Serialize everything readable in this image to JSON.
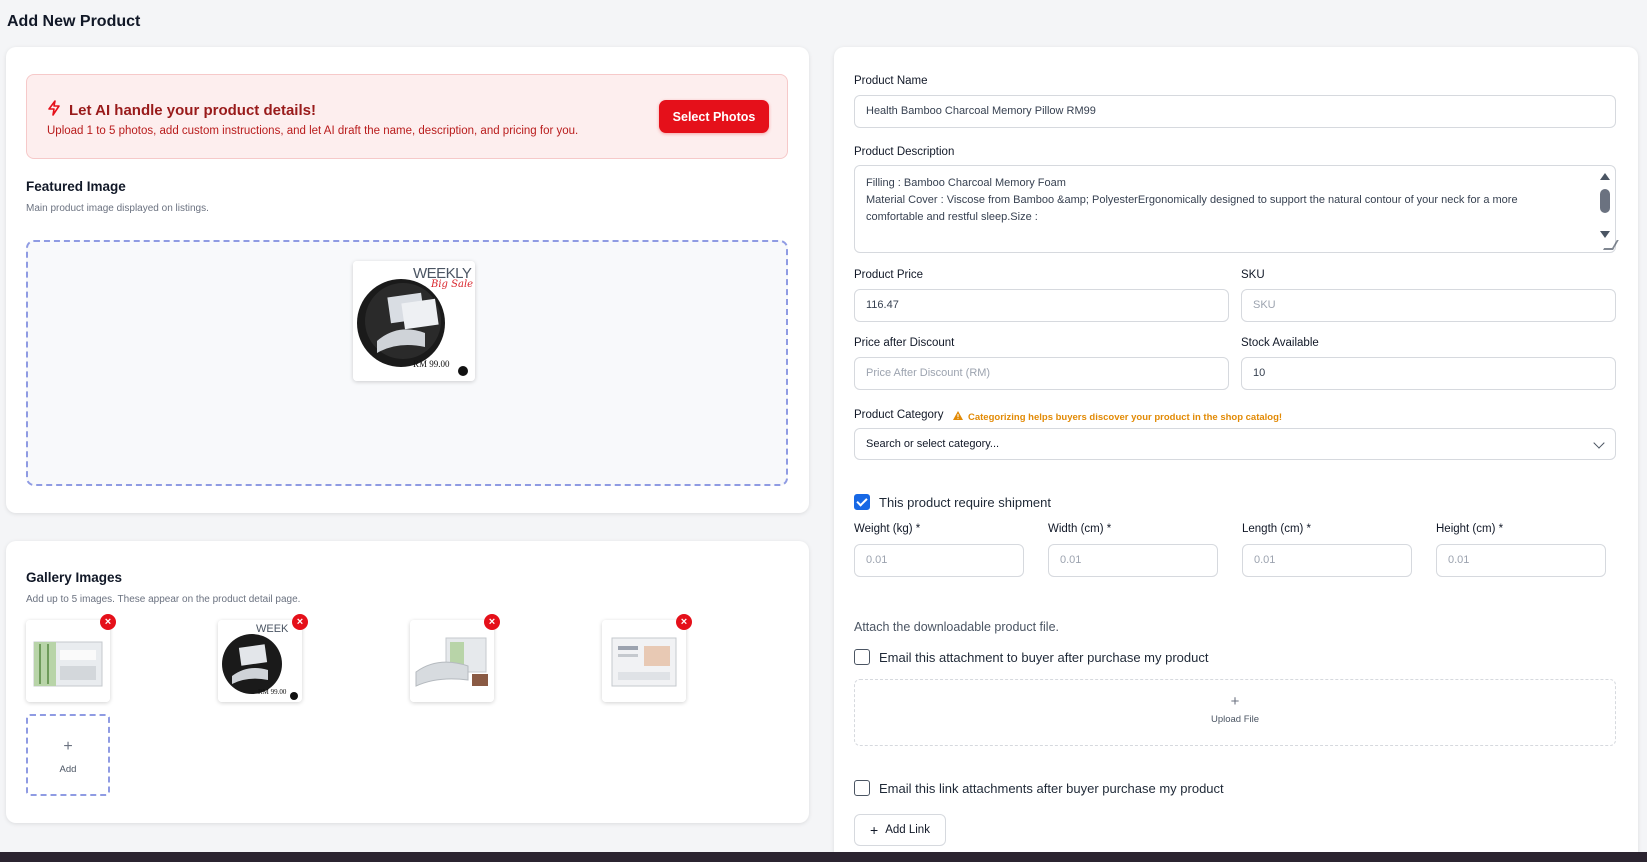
{
  "page": {
    "title": "Add New Product"
  },
  "ai": {
    "title": "Let AI handle your product details!",
    "subtitle": "Upload 1 to 5 photos, add custom instructions, and let AI draft the name, description, and pricing for you.",
    "button": "Select Photos",
    "accent": "#e5101a"
  },
  "featured": {
    "title": "Featured Image",
    "subtitle": "Main product image displayed on listings.",
    "thumb": {
      "headline": "WEEKLY",
      "script": "Big Sale",
      "price": "RM 99.00"
    }
  },
  "gallery": {
    "title": "Gallery Images",
    "subtitle": "Add up to 5 images. These appear on the product detail page.",
    "add_label": "Add",
    "remove_glyph": "×",
    "items": [
      {
        "name": "bamboo-pillow-box"
      },
      {
        "name": "weekly-sale-pillow",
        "headline": "WEEK",
        "price": "RM 99.00"
      },
      {
        "name": "pillow-with-packaging"
      },
      {
        "name": "pillow-box-white"
      }
    ]
  },
  "form": {
    "name_label": "Product Name",
    "name_value": "Health Bamboo Charcoal Memory Pillow RM99",
    "desc_label": "Product Description",
    "desc_line1": "Filling : Bamboo Charcoal Memory Foam",
    "desc_line2": "Material Cover : Viscose from Bamboo &amp; PolyesterErgonomically designed to support the natural contour of your neck for a more comfortable and restful sleep.Size :",
    "price_label": "Product Price",
    "price_value": "116.47",
    "sku_label": "SKU",
    "sku_placeholder": "SKU",
    "discount_label": "Price after Discount",
    "discount_placeholder": "Price After Discount (RM)",
    "stock_label": "Stock Available",
    "stock_value": "10",
    "category_label": "Product Category",
    "category_warning": "Categorizing helps buyers discover your product in the shop catalog!",
    "category_placeholder": "Search or select category...",
    "warning_color": "#e28a05"
  },
  "shipping": {
    "checkbox_label": "This product require shipment",
    "checked": true,
    "weight_label": "Weight (kg) *",
    "width_label": "Width (cm) *",
    "length_label": "Length (cm) *",
    "height_label": "Height (cm) *",
    "placeholder": "0.01"
  },
  "download": {
    "text": "Attach the downloadable product file.",
    "email_attachment_label": "Email this attachment to buyer after purchase my product",
    "upload_label": "Upload File",
    "email_link_label": "Email this link attachments after buyer purchase my product",
    "add_link_label": "Add Link"
  }
}
